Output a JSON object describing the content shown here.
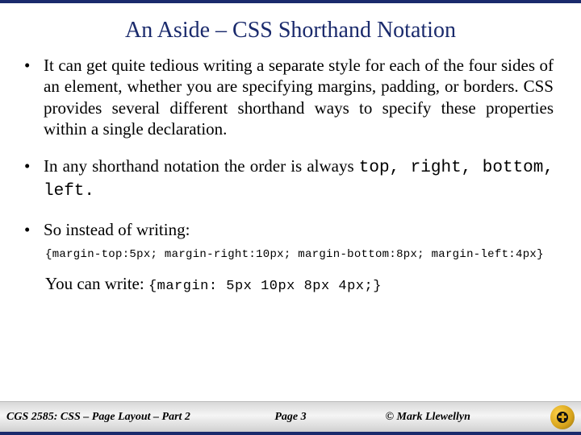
{
  "title": "An Aside – CSS Shorthand Notation",
  "bullets": {
    "b1": "It can get quite tedious writing a separate style for each of the four sides of an element, whether you are specifying margins, padding, or borders. CSS provides several different shorthand ways to specify these properties within a single declaration.",
    "b2_pre": "In any shorthand notation the order is always ",
    "b2_code": "top, right, bottom, left.",
    "b3": "So instead of writing:"
  },
  "code_long": "{margin-top:5px; margin-right:10px; margin-bottom:8px; margin-left:4px}",
  "after_pre": "You can write: ",
  "after_code": "{margin: 5px 10px 8px 4px;}",
  "footer": {
    "left": "CGS 2585: CSS – Page Layout – Part 2",
    "center": "Page 3",
    "right": "© Mark Llewellyn"
  }
}
